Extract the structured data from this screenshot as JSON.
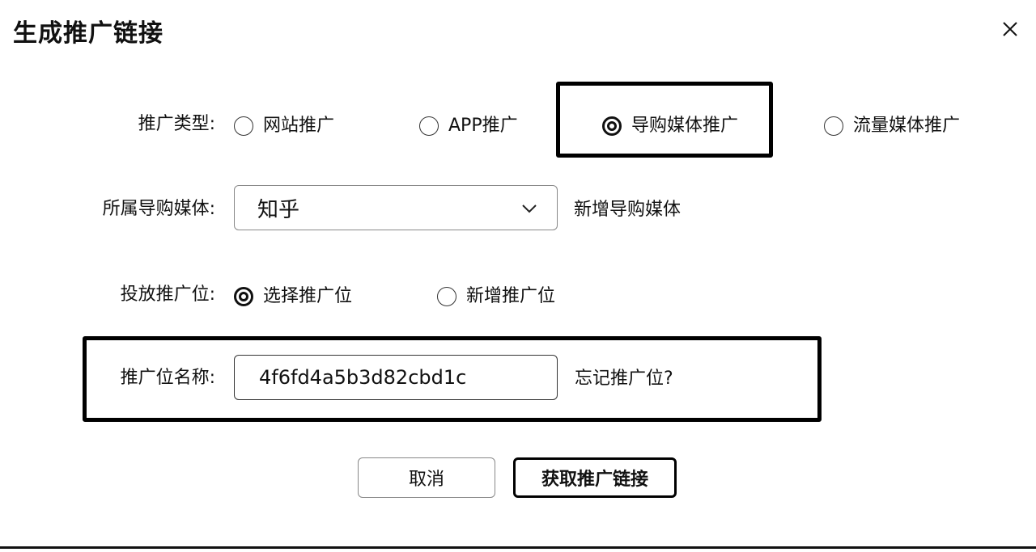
{
  "dialog": {
    "title": "生成推广链接"
  },
  "promo_type": {
    "label": "推广类型:",
    "options": [
      {
        "label": "网站推广",
        "checked": false
      },
      {
        "label": "APP推广",
        "checked": false
      },
      {
        "label": "导购媒体推广",
        "checked": true
      },
      {
        "label": "流量媒体推广",
        "checked": false
      }
    ]
  },
  "media": {
    "label": "所属导购媒体:",
    "selected": "知乎",
    "add_link": "新增导购媒体"
  },
  "placement": {
    "label": "投放推广位:",
    "options": [
      {
        "label": "选择推广位",
        "checked": true
      },
      {
        "label": "新增推广位",
        "checked": false
      }
    ]
  },
  "placement_name": {
    "label": "推广位名称:",
    "value": "4f6fd4a5b3d82cbd1c",
    "forgot_link": "忘记推广位?"
  },
  "buttons": {
    "cancel": "取消",
    "submit": "获取推广链接"
  }
}
